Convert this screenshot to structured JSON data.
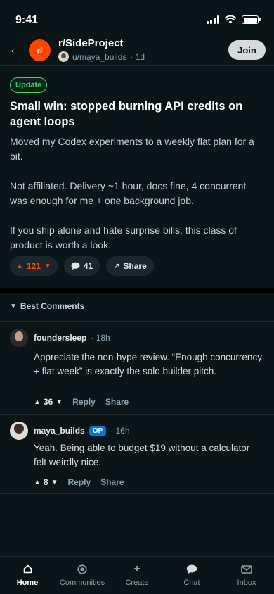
{
  "status_bar": {
    "time": "9:41"
  },
  "header": {
    "back_icon": "←",
    "subreddit_icon_label": "r/",
    "subreddit": "r/SideProject",
    "author": "u/maya_builds",
    "age": "· 1d",
    "join_label": "Join"
  },
  "post": {
    "flair": "Update",
    "title": "Small win: stopped burning API credits on agent loops",
    "paragraphs": [
      "Moved my Codex experiments to a weekly flat plan for a bit.",
      "Not affiliated. Delivery ~1 hour, docs fine, 4 concurrent was enough for me + one background job.",
      "If you ship alone and hate surprise bills, this class of product is worth a look."
    ],
    "upvotes": "121",
    "comments": "41",
    "share_label": "Share"
  },
  "comments_section": {
    "sort_label": "Best Comments",
    "items": [
      {
        "user": "foundersleep",
        "time": "· 18h",
        "body": "Appreciate the non-hype review. “Enough concurrency + flat week” is exactly the solo builder pitch.",
        "votes": "36",
        "reply_label": "Reply",
        "share_label": "Share"
      },
      {
        "user": "maya_builds",
        "badge": "OP",
        "time": "· 16h",
        "body": "Yeah. Being able to budget $19 without a calculator felt weirdly nice.",
        "votes": "8",
        "reply_label": "Reply",
        "share_label": "Share"
      }
    ]
  },
  "bottom_nav": {
    "items": [
      {
        "label": "Home",
        "icon": "home-icon"
      },
      {
        "label": "Communities",
        "icon": "communities-icon"
      },
      {
        "label": "Create",
        "icon": "plus-icon"
      },
      {
        "label": "Chat",
        "icon": "chat-icon"
      },
      {
        "label": "Inbox",
        "icon": "inbox-icon"
      }
    ]
  },
  "colors": {
    "background": "#0b1416",
    "accent": "#ff4500",
    "flair": "#46d160",
    "op_badge": "#0079d3"
  }
}
